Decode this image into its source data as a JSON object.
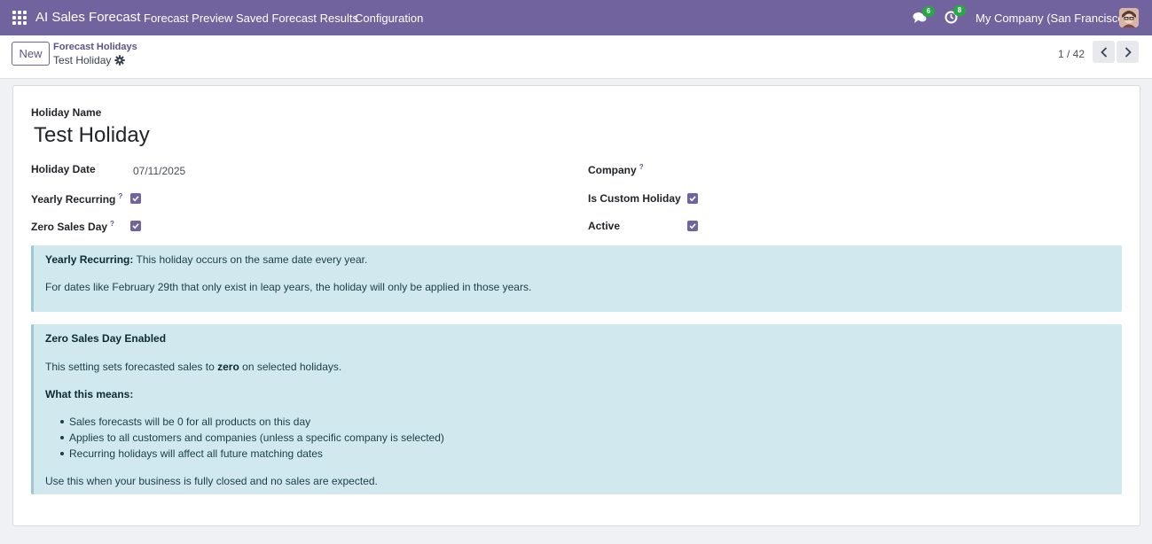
{
  "navbar": {
    "brand": "AI Sales Forecast",
    "menu": [
      "Forecast Preview",
      "Saved Forecast Results",
      "Configuration"
    ],
    "messages_count": "6",
    "activities_count": "8",
    "company": "My Company (San Francisco)"
  },
  "control_panel": {
    "new_label": "New",
    "breadcrumb_parent": "Forecast Holidays",
    "breadcrumb_current": "Test Holiday",
    "pager": "1 / 42"
  },
  "form": {
    "holiday_name_label": "Holiday Name",
    "holiday_name": "Test Holiday",
    "holiday_date_label": "Holiday Date",
    "holiday_date": "07/11/2025",
    "company_label": "Company",
    "company_value": "",
    "yearly_recurring_label": "Yearly Recurring",
    "yearly_recurring": true,
    "is_custom_holiday_label": "Is Custom Holiday",
    "is_custom_holiday": true,
    "zero_sales_day_label": "Zero Sales Day",
    "zero_sales_day": true,
    "active_label": "Active",
    "active": true,
    "help_mark": "?"
  },
  "alerts": {
    "recurring_title": "Yearly Recurring:",
    "recurring_text": "This holiday occurs on the same date every year.",
    "recurring_note": "For dates like February 29th that only exist in leap years, the holiday will only be applied in those years.",
    "zero_title": "Zero Sales Day Enabled",
    "zero_text_before": "This setting sets forecasted sales to",
    "zero_text_bold": "zero",
    "zero_text_after": "on selected holidays.",
    "zero_means_title": "What this means:",
    "zero_bullets": [
      "Sales forecasts will be 0 for all products on this day",
      "Applies to all customers and companies (unless a specific company is selected)",
      "Recurring holidays will affect all future matching dates"
    ],
    "zero_footer": "Use this when your business is fully closed and no sales are expected."
  },
  "colors": {
    "navbar": "#71639e",
    "alert_bg": "#d1e9ee",
    "checkbox": "#71639e",
    "badge": "#28a745"
  },
  "icons": [
    "apps-grid-icon",
    "chat-icon",
    "clock-icon",
    "gear-icon",
    "chevron-left-icon",
    "chevron-right-icon",
    "check-icon"
  ]
}
